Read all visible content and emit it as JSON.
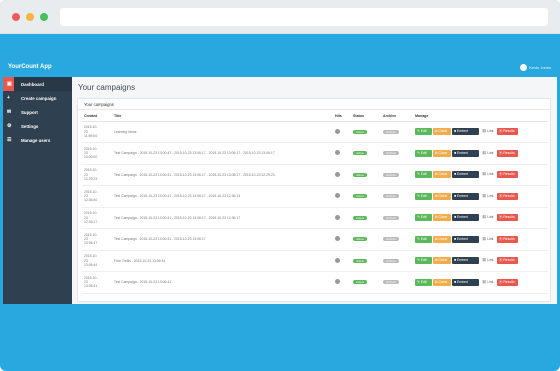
{
  "app": {
    "brand": "YourCount App",
    "user_name": "Kevin Jones"
  },
  "sidebar": {
    "items": [
      {
        "label": "Dashboard",
        "icon": "dashboard-icon",
        "glyph": "▣"
      },
      {
        "label": "Create campaign",
        "icon": "plus-icon",
        "glyph": "+"
      },
      {
        "label": "Support",
        "icon": "support-icon",
        "glyph": "✉"
      },
      {
        "label": "Settings",
        "icon": "gear-icon",
        "glyph": "⚙"
      },
      {
        "label": "Manage users",
        "icon": "users-icon",
        "glyph": "☰"
      }
    ]
  },
  "main": {
    "page_title": "Your campaigns",
    "panel_title": "Your campaigns",
    "columns": {
      "created": "Created",
      "title": "Title",
      "hits": "Hits",
      "status": "Status",
      "archive": "Archive",
      "manage": "Manage"
    },
    "buttons": {
      "edit": "✎ Edit",
      "clone": "⧉ Clone",
      "embed": "■ Embed",
      "link": "⛓ Link",
      "results": "⦿ Results"
    },
    "rows": [
      {
        "created": "2015-10-\n23\n11:59:54",
        "title": "Learning Ideas",
        "status": "Active",
        "archive": "Archive"
      },
      {
        "created": "2015-10-\n23\n13:00:00",
        "title": "Test Campaign - 2015-10-23 13:00:47 - 2015-10-23 13:06:17 - 2015-10-23 13:06:17 - 2015-10-23 13:06:17",
        "status": "Active",
        "archive": "Archive"
      },
      {
        "created": "2015-10-\n23\n12:29:23",
        "title": "Test Campaign - 2015-10-23 13:00:41 - 2015-10-23 13:06:17 - 2015-10-23 13:06:17 - 2015-10-23 12:29:23",
        "status": "Active",
        "archive": "Archive"
      },
      {
        "created": "2015-10-\n23\n12:36:40",
        "title": "Test Campaign - 2015-10-23 13:00:41 - 2015-10-23 13:06:17 - 2015-10-23 12:36:13",
        "status": "Active",
        "archive": "Archive"
      },
      {
        "created": "2015-10-\n23\n12:36:17",
        "title": "Test Campaign - 2015-10-23 13:00:41 - 2015-10-23 13:06:17 - 2015-10-23 12:36:17",
        "status": "Active",
        "archive": "Archive"
      },
      {
        "created": "2015-10-\n23\n13:06:17",
        "title": "Test Campaign - 2015-10-23 13:00:41 - 2015-10-23 13:06:17",
        "status": "Active",
        "archive": "Archive"
      },
      {
        "created": "2015-10-\n23\n13:06:44",
        "title": "Free Trellis - 2015-10-23 13:06:44",
        "status": "Active",
        "archive": "Archive"
      },
      {
        "created": "2015-10-\n23\n13:06:41",
        "title": "Test Campaign - 2015-10-23 13:06:41",
        "status": "Active",
        "archive": "Archive"
      }
    ]
  }
}
